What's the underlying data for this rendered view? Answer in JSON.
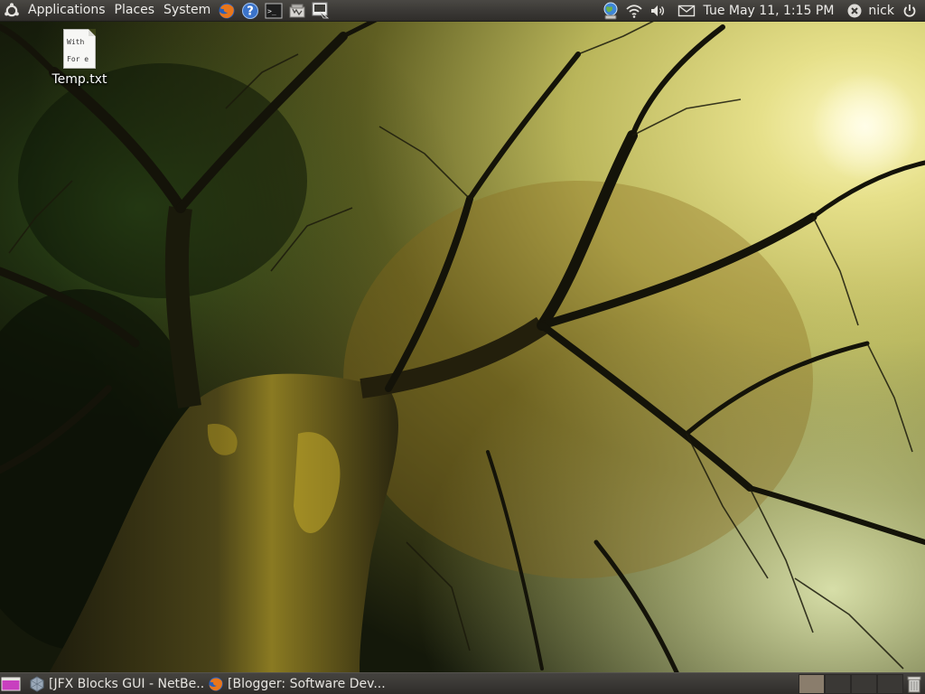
{
  "top_panel": {
    "menus": [
      {
        "label": "Applications"
      },
      {
        "label": "Places"
      },
      {
        "label": "System"
      }
    ],
    "launchers": [
      {
        "icon": "firefox-icon"
      },
      {
        "icon": "help-icon"
      },
      {
        "icon": "terminal-icon"
      },
      {
        "icon": "screenshot-icon"
      },
      {
        "icon": "remote-desktop-icon"
      }
    ],
    "indicators": [
      {
        "icon": "network-globe-icon"
      },
      {
        "icon": "wifi-icon"
      },
      {
        "icon": "volume-icon"
      },
      {
        "icon": "mail-icon"
      }
    ],
    "clock": "Tue May 11,  1:15 PM",
    "user": "nick",
    "accent": "#dd4814"
  },
  "desktop": {
    "icons": [
      {
        "label": "Temp.txt",
        "preview_lines": [
          "With",
          "For e"
        ]
      }
    ]
  },
  "bottom_panel": {
    "tasks": [
      {
        "label": "[JFX Blocks GUI - NetBe...",
        "icon": "netbeans-icon"
      },
      {
        "label": "[Blogger: Software Dev...",
        "icon": "firefox-icon"
      }
    ],
    "workspaces": 4,
    "active_workspace": 1
  }
}
